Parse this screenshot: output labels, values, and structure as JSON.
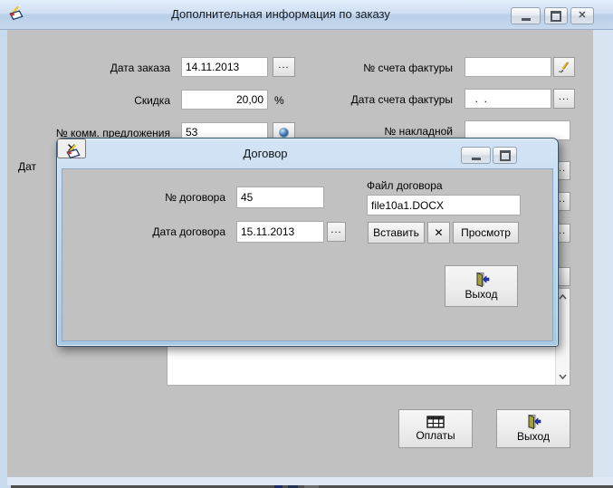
{
  "window": {
    "title": "Дополнительная информация по заказу",
    "fields": {
      "order_date": {
        "label": "Дата заказа",
        "value": "14.11.2013"
      },
      "discount": {
        "label": "Скидка",
        "value": "20,00",
        "unit": "%"
      },
      "offer_number": {
        "label": "№ комм. предложения",
        "value": "53"
      },
      "partial_label": "Дат",
      "invoice_number": {
        "label": "№ счета фактуры",
        "value": ""
      },
      "invoice_date": {
        "label": "Дата счета фактуры",
        "value": "  .  ."
      },
      "waybill_number": {
        "label": "№ накладной",
        "value": ""
      }
    },
    "memo_value": "",
    "buttons": {
      "payments": "Оплаты",
      "exit": "Выход",
      "ellipsis": "..."
    }
  },
  "dialog": {
    "title": "Договор",
    "fields": {
      "contract_number": {
        "label": "№ договора",
        "value": "45"
      },
      "contract_file": {
        "label": "Файл договора",
        "value": "file10a1.DOCX"
      },
      "contract_date": {
        "label": "Дата договора",
        "value": "15.11.2013"
      }
    },
    "buttons": {
      "insert": "Вставить",
      "delete_mark": "✕",
      "preview": "Просмотр",
      "exit": "Выход",
      "ellipsis": "..."
    }
  },
  "icons": {
    "close_glyph": "✕",
    "app_icon": "order-note-with-pencil",
    "edit_pencil": "pencil",
    "offer_globe": "blue-sphere",
    "payments_grid": "table-grid",
    "exit_door": "open-door-blue-arrow"
  },
  "colors": {
    "titlebar_blue": "#b9cfe8",
    "client_gray": "#c1c1c1",
    "close_red": "#c13a22",
    "focus_blue": "#3c7fb1",
    "delete_red": "#b01212"
  }
}
